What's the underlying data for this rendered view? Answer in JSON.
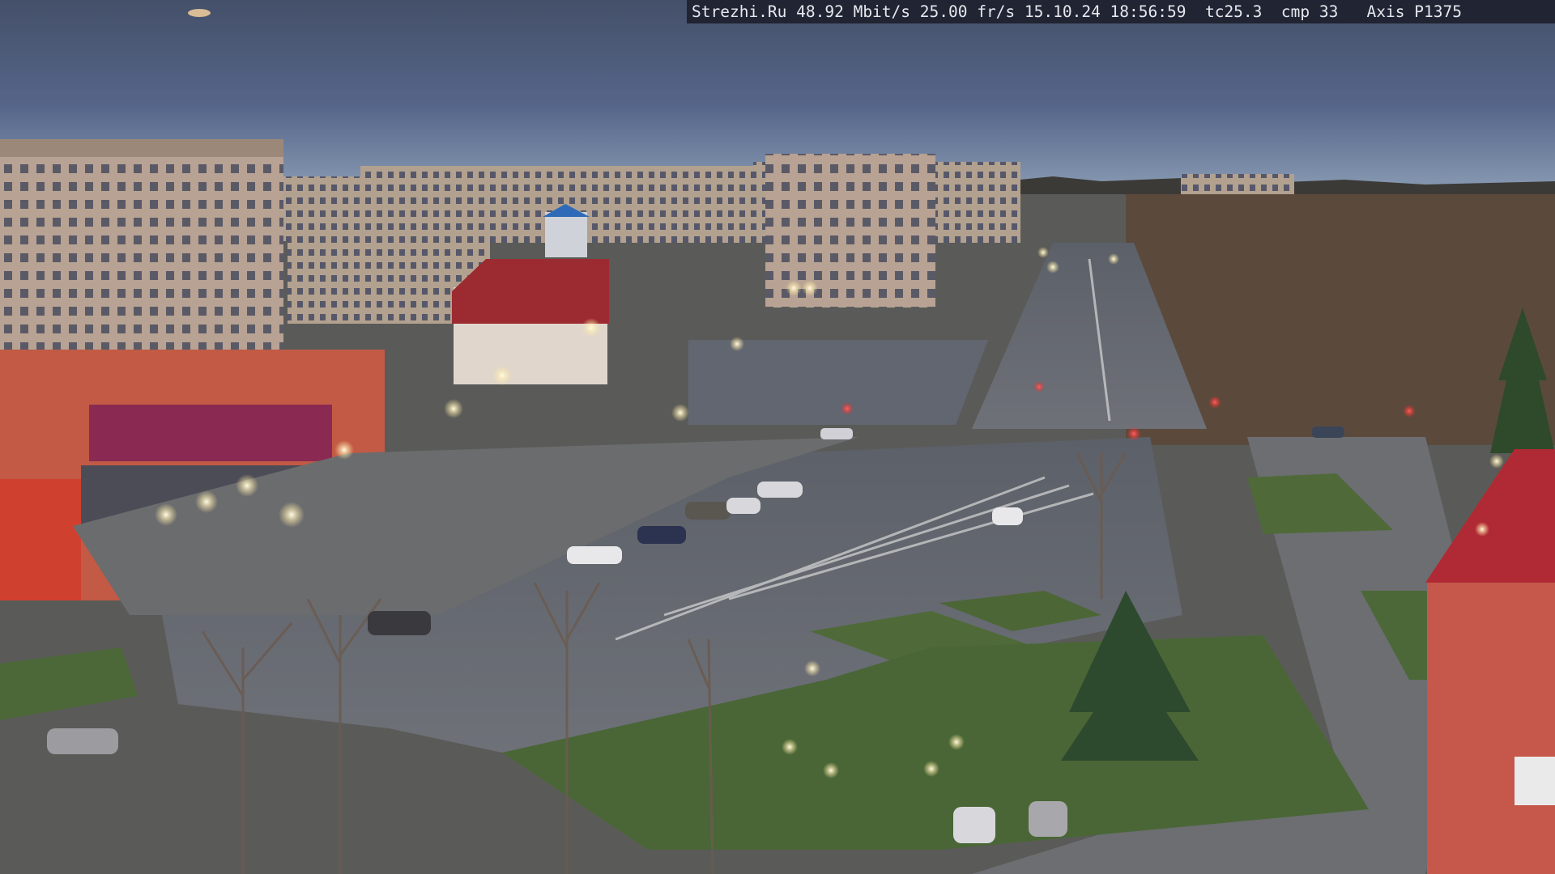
{
  "osd": {
    "text": "Strezhi.Ru 48.92 Mbit/s 25.00 fr/s 15.10.24 18:56:59  tc25.3  cmp 33   Axis P1375"
  },
  "colors": {
    "sky_top": "#46536c",
    "sky_mid": "#56668a",
    "sky_horizon": "#8ea0b8",
    "asphalt": "#6d7077",
    "grass": "#4f6a38",
    "brick": "#c25a45",
    "panel_building": "#b79e8c",
    "street_light": "#fff4c8"
  }
}
